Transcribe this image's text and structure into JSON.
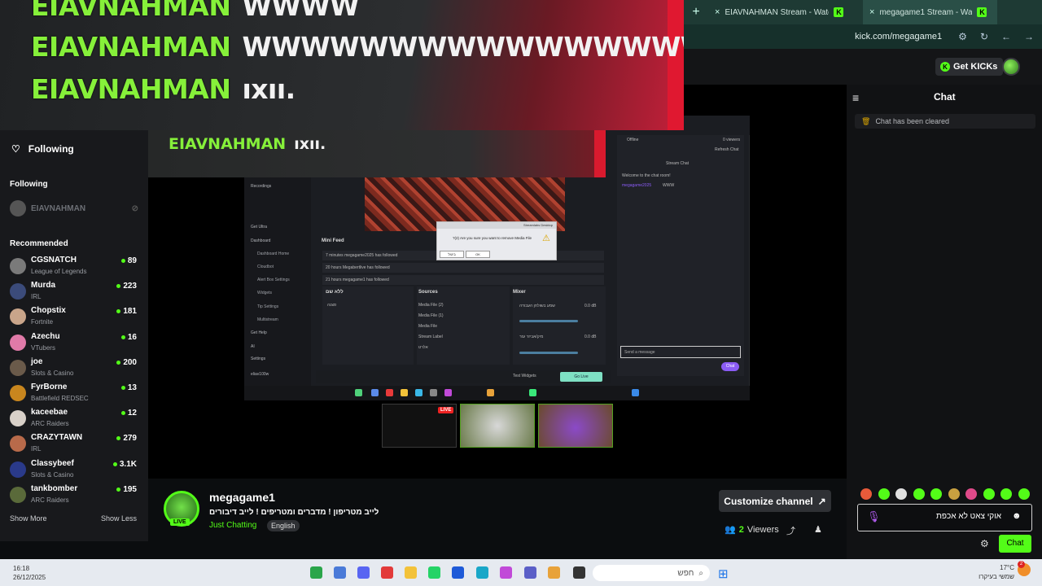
{
  "browser": {
    "new_tab": "+",
    "tabs": [
      {
        "title": "EIAVNAHMAN Stream - Watch Live on Kick",
        "close": "×",
        "active": false
      },
      {
        "title": "megagame1 Stream - Watch Live on Kick",
        "close": "×",
        "active": true
      }
    ],
    "url": "kick.com/megagame1"
  },
  "header": {
    "get_kicks": "Get KICKs"
  },
  "overlay": {
    "lines": [
      {
        "user": "EIAVNAHMAN",
        "msg": "WWWW"
      },
      {
        "user": "EIAVNAHMAN",
        "msg": "WWWWWWWWWWWWWWWW"
      },
      {
        "user": "EIAVNAHMAN",
        "msg": "ıxıı."
      }
    ],
    "inner_line": {
      "user": "EIAVNAHMAN",
      "msg": "ıxıı."
    }
  },
  "sidebar": {
    "following_title": "Following",
    "following_section": "Following",
    "following": [
      {
        "name": "EIAVNAHMAN"
      }
    ],
    "recommended_section": "Recommended",
    "recommended": [
      {
        "name": "CGSNATCH",
        "category": "League of Legends",
        "viewers": "89",
        "color": "#7a7a7a"
      },
      {
        "name": "Murda",
        "category": "IRL",
        "viewers": "223",
        "color": "#3b4b7a"
      },
      {
        "name": "Chopstix",
        "category": "Fortnite",
        "viewers": "181",
        "color": "#c9a58a"
      },
      {
        "name": "Azechu",
        "category": "VTubers",
        "viewers": "16",
        "color": "#e07aa8"
      },
      {
        "name": "joe",
        "category": "Slots & Casino",
        "viewers": "200",
        "color": "#6a5a4a"
      },
      {
        "name": "FyrBorne",
        "category": "Battlefield REDSEC",
        "viewers": "13",
        "color": "#c8861e"
      },
      {
        "name": "kaceebae",
        "category": "ARC Raiders",
        "viewers": "12",
        "color": "#d8d0c8"
      },
      {
        "name": "CRAZYTAWN",
        "category": "IRL",
        "viewers": "279",
        "color": "#b86a4a"
      },
      {
        "name": "Classybeef",
        "category": "Slots & Casino",
        "viewers": "3.1K",
        "color": "#2a3a8a"
      },
      {
        "name": "tankbomber",
        "category": "ARC Raiders",
        "viewers": "195",
        "color": "#5a6a3a"
      }
    ],
    "show_more": "Show More",
    "show_less": "Show Less"
  },
  "stream": {
    "obs": {
      "nav": [
        "Recordings",
        "Get Ultra",
        "Dashboard",
        "Get Help",
        "AI",
        "Settings",
        "eliav100w"
      ],
      "dash_sub": [
        "Dashboard Home",
        "Cloudbot",
        "Alert Box Settings",
        "Widgets",
        "Tip Settings",
        "Multistream"
      ],
      "mini_feed_title": "Mini Feed",
      "feed": [
        {
          "time": "7 minutes",
          "text": "megagame2025 has followed"
        },
        {
          "time": "20 hours",
          "text": "Megabertlive has followed"
        },
        {
          "time": "21 hours",
          "text": "megagame1 has followed"
        }
      ],
      "scenes_title": "ללא שם",
      "scene_item": "סצנה",
      "sources_title": "Sources",
      "sources": [
        "Media File (2)",
        "Media File (1)",
        "Media File",
        "Stream Label",
        "אלרט"
      ],
      "mixer_title": "Mixer",
      "mixer": [
        {
          "name": "שמע בשולחן העבודה",
          "db": "0.0 dB"
        },
        {
          "name": "מיק/אביזר עזר",
          "db": "0.0 dB"
        }
      ],
      "test_widgets": "Test Widgets",
      "go_live": "Go Live",
      "chat_status": "Offline",
      "chat_viewers": "0 viewers",
      "refresh_chat": "Refresh Chat",
      "stream_chat_title": "Stream Chat",
      "welcome": "Welcome to the chat room!",
      "chat_msg_user": "megagame2025",
      "chat_msg_text": "WWW",
      "send_placeholder": "Send a message",
      "chat_button": "Chat",
      "dialog_title": "Streamlabs Desktop",
      "dialog_text": "?(2) Are you sure you want to remove Media File",
      "dialog_ok": "OK",
      "dialog_cancel": "ביטול"
    },
    "live_badge": "LIVE"
  },
  "channel": {
    "name": "megagame1",
    "title": "לייב מטריפון ! מדברים ומטריפים ! לייב דיבורים",
    "category": "Just Chatting",
    "tag": "English",
    "live_badge": "LIVE",
    "customize": "Customize channel",
    "viewers_count": "2",
    "viewers_label": "Viewers"
  },
  "chat": {
    "title": "Chat",
    "cleared": "Chat has been cleared",
    "input_text": "אוקי צאט לא אכפת",
    "send_button": "Chat",
    "emote_colors": [
      "#e85a3a",
      "#53fc18",
      "#e0e0e0",
      "#53fc18",
      "#53fc18",
      "#c8a040",
      "#e04a8a",
      "#53fc18",
      "#53fc18",
      "#53fc18"
    ]
  },
  "taskbar": {
    "time": "16:18",
    "date": "26/12/2025",
    "search_placeholder": "חפש",
    "temperature": "17°C",
    "weather": "שמשי בעיקרו",
    "notification_count": "2"
  }
}
